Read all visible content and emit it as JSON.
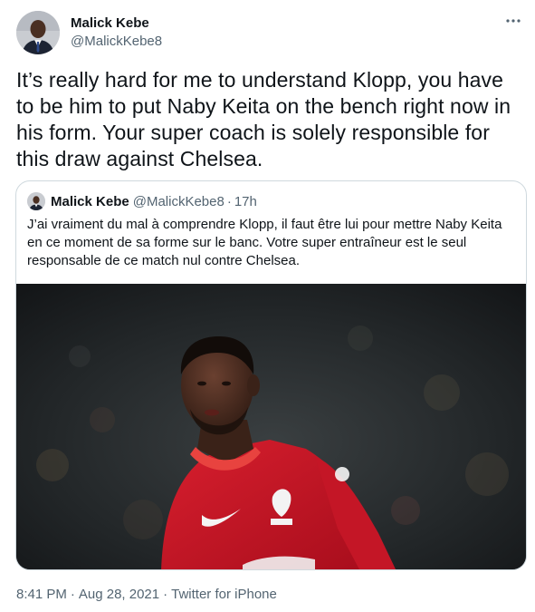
{
  "author": {
    "display_name": "Malick Kebe",
    "handle": "@MalickKebe8"
  },
  "tweet": {
    "text": "It’s really hard for me to understand Klopp, you have to be him to put Naby Keita on the bench right now in his form. Your super coach is solely responsible for this draw against Chelsea."
  },
  "quoted_tweet": {
    "display_name": "Malick Kebe",
    "handle": "@MalickKebe8",
    "separator": "·",
    "time": "17h",
    "text": "J’ai vraiment du mal à comprendre Klopp, il faut être lui pour mettre Naby Keita en ce moment de sa forme sur le banc. Votre super entraîneur est le seul responsable de ce match nul contre Chelsea."
  },
  "meta": {
    "time": "8:41 PM",
    "separator": "·",
    "date": "Aug 28, 2021",
    "source": "Twitter for iPhone"
  },
  "icons": {
    "more": "more-horizontal-icon",
    "avatar": "profile-photo",
    "media": "player-photo"
  },
  "colors": {
    "text_primary": "#0f1419",
    "text_secondary": "#536471",
    "border": "#cfd9de",
    "jersey_red": "#c8102e"
  }
}
